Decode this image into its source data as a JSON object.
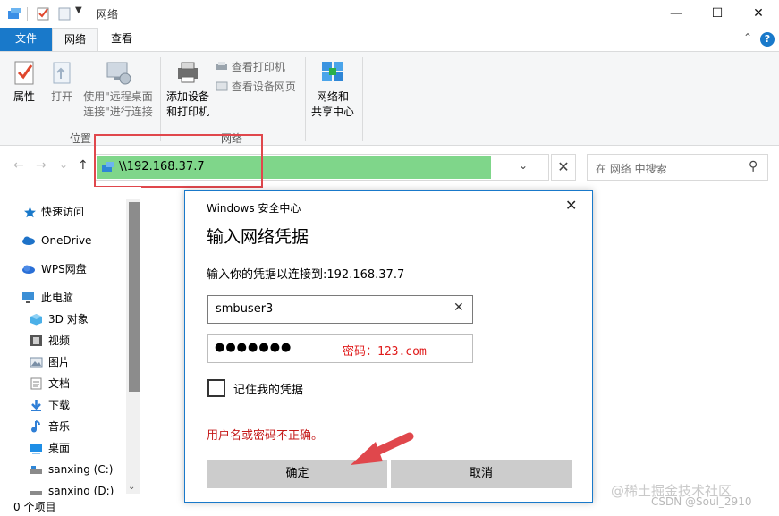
{
  "window": {
    "title": "网络",
    "controls": {
      "minimize": "—",
      "maximize": "☐",
      "close": "✕"
    }
  },
  "ribbon": {
    "tabs": [
      "文件",
      "网络",
      "查看"
    ],
    "collapse_glyph": "⌃",
    "help_glyph": "?",
    "groups": [
      {
        "label": "位置",
        "buttons": [
          {
            "label": "属性",
            "icon": "properties-icon"
          },
          {
            "label": "打开",
            "icon": "open-icon"
          },
          {
            "label_line1": "使用\"远程桌面",
            "label_line2": "连接\"进行连接",
            "icon": "remote-desktop-icon"
          }
        ]
      },
      {
        "label": "网络",
        "buttons": [
          {
            "label_line1": "添加设备",
            "label_line2": "和打印机",
            "icon": "add-device-icon"
          }
        ],
        "small_buttons": [
          {
            "label": "查看打印机",
            "icon": "printer-icon"
          },
          {
            "label": "查看设备网页",
            "icon": "device-webpage-icon"
          }
        ]
      },
      {
        "label": "",
        "buttons": [
          {
            "label_line1": "网络和",
            "label_line2": "共享中心",
            "icon": "network-sharing-icon"
          }
        ]
      }
    ]
  },
  "nav": {
    "back": "←",
    "forward": "→",
    "history": "⌄",
    "up": "↑",
    "address": "\\\\192.168.37.7",
    "dropdown": "⌄",
    "clear": "✕",
    "search_placeholder": "在 网络 中搜索",
    "search_glyph": "⚲"
  },
  "sidebar": {
    "items": [
      {
        "label": "快速访问",
        "icon": "star-icon",
        "color": "#1979ca"
      },
      {
        "label": "OneDrive",
        "icon": "cloud-icon",
        "color": "#1e72c8"
      },
      {
        "label": "WPS网盘",
        "icon": "wps-cloud-icon",
        "color": "#2a6fd6"
      },
      {
        "label": "此电脑",
        "icon": "computer-icon",
        "color": "#3b8fd6"
      },
      {
        "label": "3D 对象",
        "icon": "cube-icon",
        "color": "#4bb0e8"
      },
      {
        "label": "视频",
        "icon": "video-icon",
        "color": "#555555"
      },
      {
        "label": "图片",
        "icon": "pictures-icon",
        "color": "#7a8fa6"
      },
      {
        "label": "文档",
        "icon": "documents-icon",
        "color": "#8a8a8a"
      },
      {
        "label": "下载",
        "icon": "download-icon",
        "color": "#2f7fd6"
      },
      {
        "label": "音乐",
        "icon": "music-icon",
        "color": "#2f7fd6"
      },
      {
        "label": "桌面",
        "icon": "desktop-icon",
        "color": "#1e8ee6"
      },
      {
        "label": "sanxing (C:)",
        "icon": "drive-icon",
        "color": "#777777"
      },
      {
        "label": "sanxing (D:)",
        "icon": "drive-icon",
        "color": "#777777"
      }
    ],
    "scroll_down": "⌄"
  },
  "status": {
    "items_text": "0 个项目"
  },
  "dialog": {
    "caption": "Windows 安全中心",
    "close_glyph": "✕",
    "title": "输入网络凭据",
    "prompt": "输入你的凭据以连接到:192.168.37.7",
    "username_value": "smbuser3",
    "clear_glyph": "✕",
    "password_dots": "●●●●●●●",
    "password_note": "密码：123.com",
    "remember_label": "记住我的凭据",
    "error": "用户名或密码不正确。",
    "ok_label": "确定",
    "cancel_label": "取消"
  },
  "watermark": {
    "site": "@稀土掘金技术社区",
    "author": "CSDN @Soul_2910"
  },
  "colors": {
    "accent": "#1979ca",
    "address_highlight": "#7fd68a",
    "annotation_red": "#e0474c",
    "error_red": "#c51a1a"
  }
}
